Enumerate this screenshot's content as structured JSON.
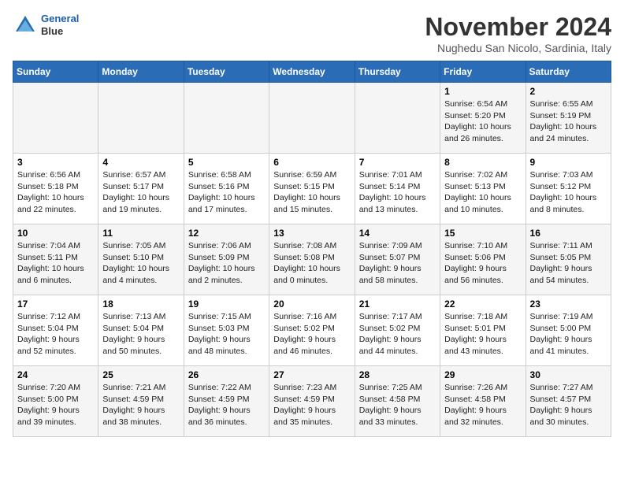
{
  "header": {
    "logo_line1": "General",
    "logo_line2": "Blue",
    "month_title": "November 2024",
    "location": "Nughedu San Nicolo, Sardinia, Italy"
  },
  "weekdays": [
    "Sunday",
    "Monday",
    "Tuesday",
    "Wednesday",
    "Thursday",
    "Friday",
    "Saturday"
  ],
  "weeks": [
    [
      {
        "day": "",
        "info": ""
      },
      {
        "day": "",
        "info": ""
      },
      {
        "day": "",
        "info": ""
      },
      {
        "day": "",
        "info": ""
      },
      {
        "day": "",
        "info": ""
      },
      {
        "day": "1",
        "info": "Sunrise: 6:54 AM\nSunset: 5:20 PM\nDaylight: 10 hours and 26 minutes."
      },
      {
        "day": "2",
        "info": "Sunrise: 6:55 AM\nSunset: 5:19 PM\nDaylight: 10 hours and 24 minutes."
      }
    ],
    [
      {
        "day": "3",
        "info": "Sunrise: 6:56 AM\nSunset: 5:18 PM\nDaylight: 10 hours and 22 minutes."
      },
      {
        "day": "4",
        "info": "Sunrise: 6:57 AM\nSunset: 5:17 PM\nDaylight: 10 hours and 19 minutes."
      },
      {
        "day": "5",
        "info": "Sunrise: 6:58 AM\nSunset: 5:16 PM\nDaylight: 10 hours and 17 minutes."
      },
      {
        "day": "6",
        "info": "Sunrise: 6:59 AM\nSunset: 5:15 PM\nDaylight: 10 hours and 15 minutes."
      },
      {
        "day": "7",
        "info": "Sunrise: 7:01 AM\nSunset: 5:14 PM\nDaylight: 10 hours and 13 minutes."
      },
      {
        "day": "8",
        "info": "Sunrise: 7:02 AM\nSunset: 5:13 PM\nDaylight: 10 hours and 10 minutes."
      },
      {
        "day": "9",
        "info": "Sunrise: 7:03 AM\nSunset: 5:12 PM\nDaylight: 10 hours and 8 minutes."
      }
    ],
    [
      {
        "day": "10",
        "info": "Sunrise: 7:04 AM\nSunset: 5:11 PM\nDaylight: 10 hours and 6 minutes."
      },
      {
        "day": "11",
        "info": "Sunrise: 7:05 AM\nSunset: 5:10 PM\nDaylight: 10 hours and 4 minutes."
      },
      {
        "day": "12",
        "info": "Sunrise: 7:06 AM\nSunset: 5:09 PM\nDaylight: 10 hours and 2 minutes."
      },
      {
        "day": "13",
        "info": "Sunrise: 7:08 AM\nSunset: 5:08 PM\nDaylight: 10 hours and 0 minutes."
      },
      {
        "day": "14",
        "info": "Sunrise: 7:09 AM\nSunset: 5:07 PM\nDaylight: 9 hours and 58 minutes."
      },
      {
        "day": "15",
        "info": "Sunrise: 7:10 AM\nSunset: 5:06 PM\nDaylight: 9 hours and 56 minutes."
      },
      {
        "day": "16",
        "info": "Sunrise: 7:11 AM\nSunset: 5:05 PM\nDaylight: 9 hours and 54 minutes."
      }
    ],
    [
      {
        "day": "17",
        "info": "Sunrise: 7:12 AM\nSunset: 5:04 PM\nDaylight: 9 hours and 52 minutes."
      },
      {
        "day": "18",
        "info": "Sunrise: 7:13 AM\nSunset: 5:04 PM\nDaylight: 9 hours and 50 minutes."
      },
      {
        "day": "19",
        "info": "Sunrise: 7:15 AM\nSunset: 5:03 PM\nDaylight: 9 hours and 48 minutes."
      },
      {
        "day": "20",
        "info": "Sunrise: 7:16 AM\nSunset: 5:02 PM\nDaylight: 9 hours and 46 minutes."
      },
      {
        "day": "21",
        "info": "Sunrise: 7:17 AM\nSunset: 5:02 PM\nDaylight: 9 hours and 44 minutes."
      },
      {
        "day": "22",
        "info": "Sunrise: 7:18 AM\nSunset: 5:01 PM\nDaylight: 9 hours and 43 minutes."
      },
      {
        "day": "23",
        "info": "Sunrise: 7:19 AM\nSunset: 5:00 PM\nDaylight: 9 hours and 41 minutes."
      }
    ],
    [
      {
        "day": "24",
        "info": "Sunrise: 7:20 AM\nSunset: 5:00 PM\nDaylight: 9 hours and 39 minutes."
      },
      {
        "day": "25",
        "info": "Sunrise: 7:21 AM\nSunset: 4:59 PM\nDaylight: 9 hours and 38 minutes."
      },
      {
        "day": "26",
        "info": "Sunrise: 7:22 AM\nSunset: 4:59 PM\nDaylight: 9 hours and 36 minutes."
      },
      {
        "day": "27",
        "info": "Sunrise: 7:23 AM\nSunset: 4:59 PM\nDaylight: 9 hours and 35 minutes."
      },
      {
        "day": "28",
        "info": "Sunrise: 7:25 AM\nSunset: 4:58 PM\nDaylight: 9 hours and 33 minutes."
      },
      {
        "day": "29",
        "info": "Sunrise: 7:26 AM\nSunset: 4:58 PM\nDaylight: 9 hours and 32 minutes."
      },
      {
        "day": "30",
        "info": "Sunrise: 7:27 AM\nSunset: 4:57 PM\nDaylight: 9 hours and 30 minutes."
      }
    ]
  ]
}
